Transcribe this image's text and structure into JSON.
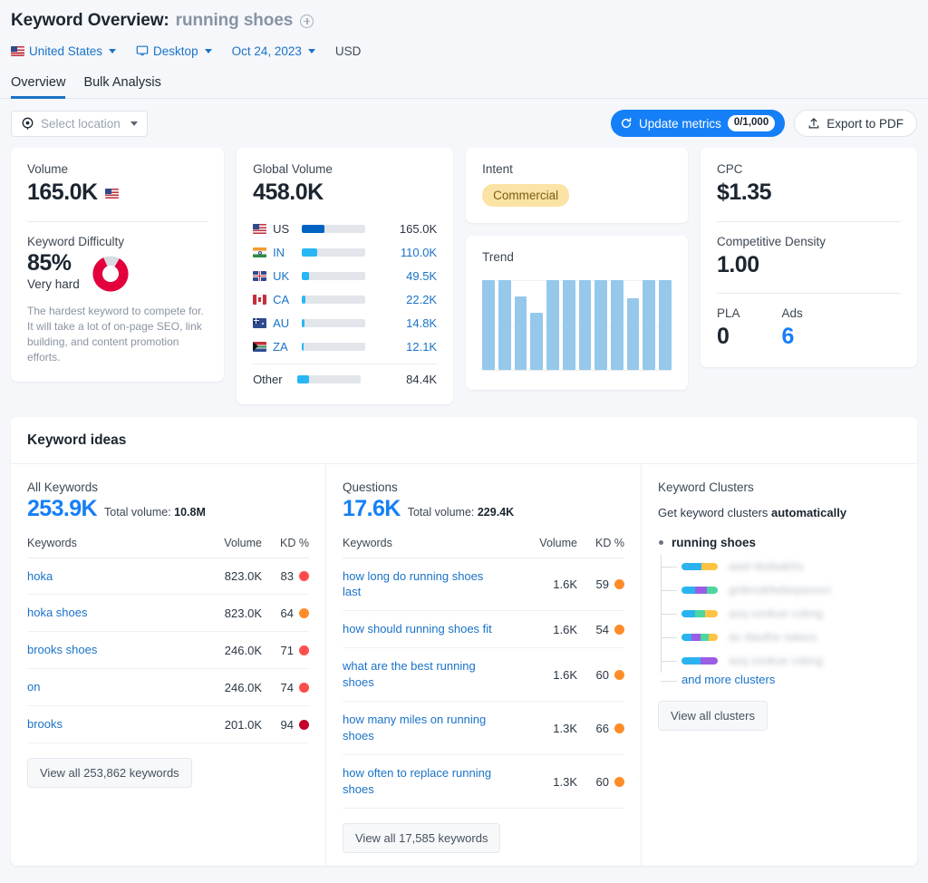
{
  "header": {
    "title_label": "Keyword Overview:",
    "keyword": "running shoes",
    "add_icon": "plus-circle-icon",
    "country": "United States",
    "device": "Desktop",
    "date": "Oct 24, 2023",
    "currency": "USD",
    "tabs": [
      {
        "label": "Overview",
        "active": true
      },
      {
        "label": "Bulk Analysis",
        "active": false
      }
    ]
  },
  "toolbar": {
    "location_placeholder": "Select location",
    "update_label": "Update metrics",
    "update_badge": "0/1,000",
    "export_label": "Export to PDF"
  },
  "volume_card": {
    "label": "Volume",
    "value": "165.0K",
    "kd_label": "Keyword Difficulty",
    "kd_value": "85%",
    "kd_level": "Very hard",
    "kd_desc": "The hardest keyword to compete for. It will take a lot of on-page SEO, link building, and content promotion efforts.",
    "kd_color": "#E3003C"
  },
  "global_volume": {
    "label": "Global Volume",
    "value": "458.0K",
    "rows": [
      {
        "code": "US",
        "value": "165.0K",
        "pct": 36,
        "color": "#0063C3"
      },
      {
        "code": "IN",
        "value": "110.0K",
        "pct": 24,
        "color": "#29B6F6"
      },
      {
        "code": "UK",
        "value": "49.5K",
        "pct": 11,
        "color": "#29B6F6"
      },
      {
        "code": "CA",
        "value": "22.2K",
        "pct": 5,
        "color": "#29B6F6"
      },
      {
        "code": "AU",
        "value": "14.8K",
        "pct": 3.5,
        "color": "#29B6F6"
      },
      {
        "code": "ZA",
        "value": "12.1K",
        "pct": 3,
        "color": "#29B6F6"
      }
    ],
    "other_label": "Other",
    "other_value": "84.4K",
    "other_pct": 18
  },
  "intent": {
    "label": "Intent",
    "value": "Commercial"
  },
  "trend": {
    "label": "Trend"
  },
  "cpc_card": {
    "cpc_label": "CPC",
    "cpc_value": "$1.35",
    "density_label": "Competitive Density",
    "density_value": "1.00",
    "pla_label": "PLA",
    "pla_value": "0",
    "ads_label": "Ads",
    "ads_value": "6"
  },
  "ideas": {
    "title": "Keyword ideas",
    "all_keywords": {
      "title": "All Keywords",
      "count": "253.9K",
      "total_label": "Total volume:",
      "total_value": "10.8M",
      "columns": [
        "Keywords",
        "Volume",
        "KD %"
      ],
      "rows": [
        {
          "keyword": "hoka",
          "volume": "823.0K",
          "kd": "83",
          "kd_color": "#FF4B4B"
        },
        {
          "keyword": "hoka shoes",
          "volume": "823.0K",
          "kd": "64",
          "kd_color": "#FF8C28"
        },
        {
          "keyword": "brooks shoes",
          "volume": "246.0K",
          "kd": "71",
          "kd_color": "#FF5050"
        },
        {
          "keyword": "on",
          "volume": "246.0K",
          "kd": "74",
          "kd_color": "#FF4B4B"
        },
        {
          "keyword": "brooks",
          "volume": "201.0K",
          "kd": "94",
          "kd_color": "#C4002A"
        }
      ],
      "view_all": "View all 253,862 keywords"
    },
    "questions": {
      "title": "Questions",
      "count": "17.6K",
      "total_label": "Total volume:",
      "total_value": "229.4K",
      "columns": [
        "Keywords",
        "Volume",
        "KD %"
      ],
      "rows": [
        {
          "keyword": "how long do running shoes last",
          "volume": "1.6K",
          "kd": "59",
          "kd_color": "#FF8C28"
        },
        {
          "keyword": "how should running shoes fit",
          "volume": "1.6K",
          "kd": "54",
          "kd_color": "#FF8C28"
        },
        {
          "keyword": "what are the best running shoes",
          "volume": "1.6K",
          "kd": "60",
          "kd_color": "#FF8C28"
        },
        {
          "keyword": "how many miles on running shoes",
          "volume": "1.3K",
          "kd": "66",
          "kd_color": "#FF8C28"
        },
        {
          "keyword": "how often to replace running shoes",
          "volume": "1.3K",
          "kd": "60",
          "kd_color": "#FF8C28"
        }
      ],
      "view_all": "View all 17,585 keywords"
    },
    "clusters": {
      "title": "Keyword Clusters",
      "subtitle_prefix": "Get keyword clusters",
      "subtitle_bold": "automatically",
      "root": "running shoes",
      "items": [
        {
          "segments": [
            "#2BB3F0",
            "#FFC344"
          ],
          "widths": [
            55,
            45
          ],
          "text": "awd dsdsakhs"
        },
        {
          "segments": [
            "#2BB3F0",
            "#9B5DE5",
            "#4DD6A0"
          ],
          "widths": [
            38,
            32,
            30
          ],
          "text": "gniknokfwlwqssxxci"
        },
        {
          "segments": [
            "#2BB3F0",
            "#4DD6A0",
            "#FFC344"
          ],
          "widths": [
            38,
            28,
            34
          ],
          "text": "asq xsnkue cxbng"
        },
        {
          "segments": [
            "#2BB3F0",
            "#9B5DE5",
            "#4DD6A0",
            "#FFC344"
          ],
          "widths": [
            28,
            24,
            24,
            24
          ],
          "text": "as dauthe salaxx"
        },
        {
          "segments": [
            "#2BB3F0",
            "#9B5DE5"
          ],
          "widths": [
            52,
            48
          ],
          "text": "asq xsnkue cxbng"
        }
      ],
      "more_link": "and more clusters",
      "view_all": "View all clusters"
    }
  },
  "chart_data": {
    "type": "bar",
    "title": "Trend",
    "categories": [
      "1",
      "2",
      "3",
      "4",
      "5",
      "6",
      "7",
      "8",
      "9",
      "10",
      "11",
      "12"
    ],
    "values": [
      100,
      100,
      82,
      64,
      100,
      100,
      100,
      100,
      100,
      80,
      100,
      100
    ],
    "xlabel": "",
    "ylabel": "",
    "ylim": [
      0,
      100
    ],
    "grid": true,
    "legend": false,
    "color": "#96C8EC"
  }
}
